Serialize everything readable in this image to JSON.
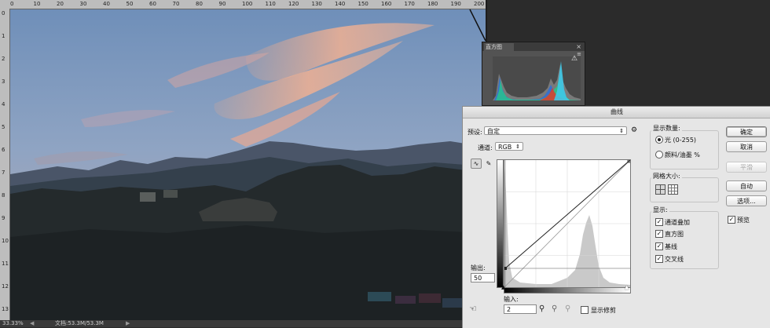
{
  "document": {
    "ruler_top_labels": [
      "0",
      "10",
      "20",
      "30",
      "40",
      "50",
      "60",
      "70",
      "80",
      "90",
      "100",
      "110",
      "120",
      "130",
      "140",
      "150",
      "160",
      "170",
      "180",
      "190",
      "200"
    ],
    "ruler_left_labels": [
      "0",
      "1",
      "2",
      "3",
      "4",
      "5",
      "6",
      "7",
      "8",
      "9",
      "10",
      "11",
      "12",
      "13"
    ],
    "status_zoom": "33.33%",
    "status_doc": "文档:53.3M/53.3M"
  },
  "histogram_panel": {
    "tab_label": "直方图",
    "close_glyph": "×",
    "menu_glyph": "≡",
    "warning_glyph": "⚠"
  },
  "curves_dialog": {
    "title": "曲线",
    "preset_label": "预设:",
    "preset_value": "自定",
    "channel_label": "通道:",
    "channel_value": "RGB",
    "output_label": "输出:",
    "output_value": "50",
    "input_label": "输入:",
    "input_value": "2",
    "show_clipping_label": "显示修剪",
    "show_amount_title": "显示数量:",
    "light_option": "光 (0-255)",
    "pigment_option": "颜料/油墨 %",
    "grid_size_title": "网格大小:",
    "show_title": "显示:",
    "show_options": [
      {
        "label": "通道叠加",
        "checked": true
      },
      {
        "label": "直方图",
        "checked": true
      },
      {
        "label": "基线",
        "checked": true
      },
      {
        "label": "交叉线",
        "checked": true
      }
    ],
    "buttons": {
      "ok": "确定",
      "cancel": "取消",
      "smooth": "平滑",
      "auto": "自动",
      "options": "选项..."
    },
    "preview_label": "预览",
    "preview_checked": true,
    "gear_glyph": "⚙"
  }
}
